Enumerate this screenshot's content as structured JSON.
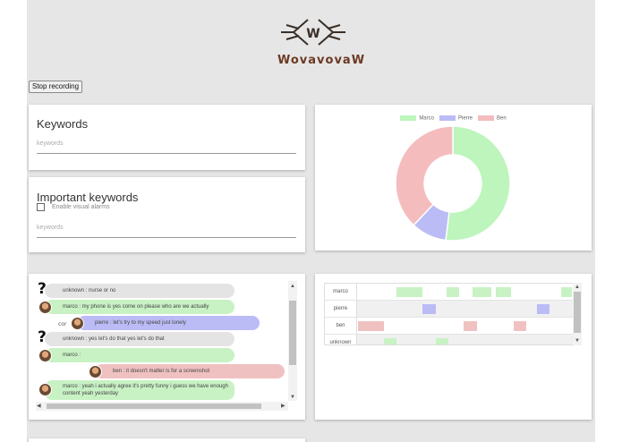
{
  "logo": {
    "letter": "W",
    "name": "WovavovaW"
  },
  "toolbar": {
    "stop_label": "Stop recording"
  },
  "keywords": {
    "title": "Keywords",
    "placeholder": "keywords"
  },
  "important": {
    "title": "Important keywords",
    "checkbox_label": "Enable visual alarms",
    "checkbox_checked": false,
    "placeholder": "keywords"
  },
  "chart_data": {
    "type": "pie",
    "variant": "doughnut",
    "categories": [
      "Marco",
      "Pierre",
      "Ben"
    ],
    "values": [
      52,
      10,
      38
    ],
    "colors": [
      "#bdf5bc",
      "#bbbcf6",
      "#f5bcbd"
    ],
    "legend_position": "top"
  },
  "chat": {
    "messages": [
      {
        "speaker": "unknown",
        "text": "unknown : nurse or no",
        "color": "#e4e4e4",
        "icon": "question-mark-icon"
      },
      {
        "speaker": "marco",
        "text": "marco : my phone is yes come on please who are we actually",
        "color": "#c8f2c4",
        "icon": "avatar"
      },
      {
        "speaker": "pierre",
        "text": "pierre : let's try to my speed just lonely",
        "color": "#bbbcf6",
        "icon": "avatar",
        "behind": "cor"
      },
      {
        "speaker": "unknown",
        "text": "unknown : yes let's do that yes let's do that",
        "color": "#e4e4e4",
        "icon": "question-mark-icon"
      },
      {
        "speaker": "marco",
        "text": "marco :",
        "color": "#c8f2c4",
        "icon": "avatar"
      },
      {
        "speaker": "ben",
        "text": "ben : it doesn't matter is for a screenshot",
        "color": "#f0c1c1",
        "icon": "avatar"
      },
      {
        "speaker": "marco",
        "text": "marco : yeah i actually agree it's pretty funny i guess we have enough content yeah yesterday",
        "color": "#c8f2c4",
        "icon": "avatar"
      }
    ]
  },
  "timeline": {
    "rows": [
      {
        "label": "marco",
        "color": "#c8f2c4",
        "segments": [
          [
            0.18,
            0.3
          ],
          [
            0.41,
            0.47
          ],
          [
            0.53,
            0.62
          ],
          [
            0.64,
            0.71
          ],
          [
            0.94,
            0.99
          ]
        ]
      },
      {
        "label": "pierre",
        "color": "#bbbcf6",
        "segments": [
          [
            0.3,
            0.36
          ],
          [
            0.83,
            0.89
          ]
        ]
      },
      {
        "label": "ben",
        "color": "#f0c1c1",
        "segments": [
          [
            0.0,
            0.12
          ],
          [
            0.49,
            0.55
          ],
          [
            0.72,
            0.78
          ]
        ]
      },
      {
        "label": "unknown",
        "color": "#c8f2c4",
        "segments": [
          [
            0.12,
            0.18
          ],
          [
            0.36,
            0.42
          ]
        ]
      }
    ]
  },
  "icons": {
    "scroll_up": "▲",
    "scroll_down": "▼",
    "scroll_left": "◀",
    "scroll_right": "▶"
  }
}
